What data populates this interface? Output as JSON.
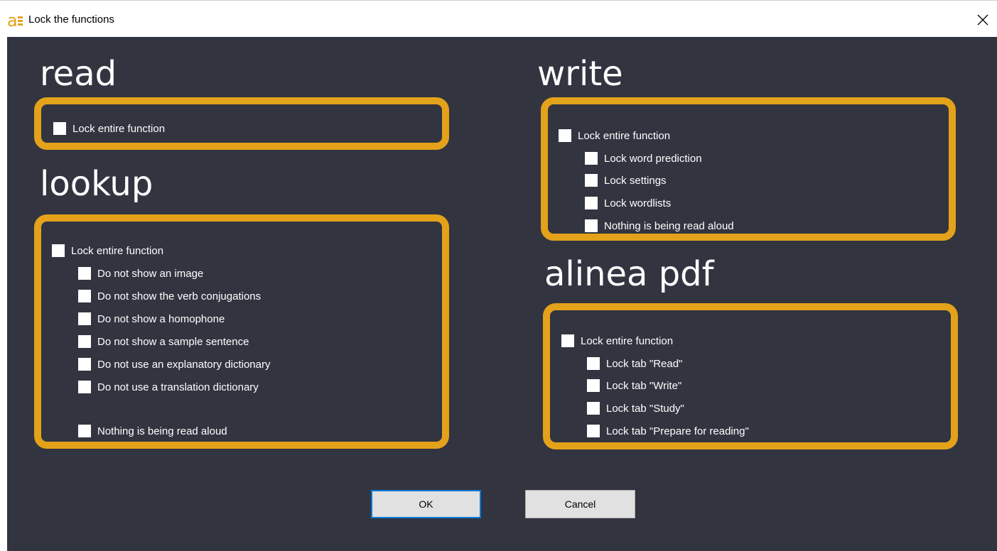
{
  "window": {
    "title": "Lock the functions",
    "close_glyph": "✕",
    "icon": "alinea-app-icon"
  },
  "sections": {
    "read": {
      "title": "read",
      "items": [
        {
          "label": "Lock entire function",
          "checked": false
        }
      ]
    },
    "lookup": {
      "title": "lookup",
      "items": [
        {
          "label": "Lock entire function",
          "checked": false
        },
        {
          "label": "Do not show an image",
          "checked": false
        },
        {
          "label": "Do not show the verb conjugations",
          "checked": false
        },
        {
          "label": "Do not show a homophone",
          "checked": false
        },
        {
          "label": "Do not show a sample sentence",
          "checked": false
        },
        {
          "label": "Do not use an explanatory dictionary",
          "checked": false
        },
        {
          "label": "Do not use a translation dictionary",
          "checked": false
        },
        {
          "label": "Nothing is being read aloud",
          "checked": false
        }
      ]
    },
    "write": {
      "title": "write",
      "items": [
        {
          "label": "Lock entire function",
          "checked": false
        },
        {
          "label": "Lock word prediction",
          "checked": false
        },
        {
          "label": "Lock settings",
          "checked": false
        },
        {
          "label": "Lock wordlists",
          "checked": false
        },
        {
          "label": "Nothing is being read aloud",
          "checked": false
        }
      ]
    },
    "pdf": {
      "title": "alinea pdf",
      "items": [
        {
          "label": "Lock entire function",
          "checked": false
        },
        {
          "label": "Lock tab \"Read\"",
          "checked": false
        },
        {
          "label": "Lock tab \"Write\"",
          "checked": false
        },
        {
          "label": "Lock tab \"Study\"",
          "checked": false
        },
        {
          "label": "Lock tab \"Prepare for reading\"",
          "checked": false
        }
      ]
    }
  },
  "buttons": {
    "ok": "OK",
    "cancel": "Cancel"
  },
  "colors": {
    "background": "#323440",
    "group_border": "#e3a21a",
    "text": "#ffffff",
    "ok_focus": "#0a78d7"
  }
}
